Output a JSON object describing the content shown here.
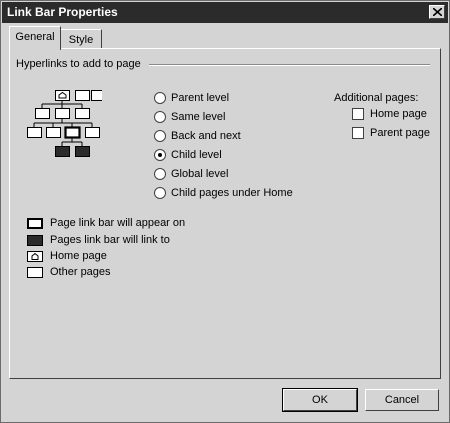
{
  "window": {
    "title": "Link Bar Properties"
  },
  "tabs": [
    {
      "label": "General",
      "active": true
    },
    {
      "label": "Style",
      "active": false
    }
  ],
  "group": {
    "label": "Hyperlinks to add to page"
  },
  "radios": [
    {
      "label": "Parent level",
      "checked": false
    },
    {
      "label": "Same level",
      "checked": false
    },
    {
      "label": "Back and next",
      "checked": false
    },
    {
      "label": "Child level",
      "checked": true
    },
    {
      "label": "Global level",
      "checked": false
    },
    {
      "label": "Child pages under Home",
      "checked": false
    }
  ],
  "additional": {
    "label": "Additional pages:",
    "items": [
      {
        "label": "Home page",
        "checked": false
      },
      {
        "label": "Parent page",
        "checked": false
      }
    ]
  },
  "legend": [
    {
      "icon": "page-link-bar-appears-icon",
      "label": "Page link bar will appear on"
    },
    {
      "icon": "linked-page-icon",
      "label": "Pages link bar will link to"
    },
    {
      "icon": "home-page-icon",
      "label": "Home page"
    },
    {
      "icon": "other-page-icon",
      "label": "Other pages"
    }
  ],
  "buttons": {
    "ok": "OK",
    "cancel": "Cancel"
  }
}
